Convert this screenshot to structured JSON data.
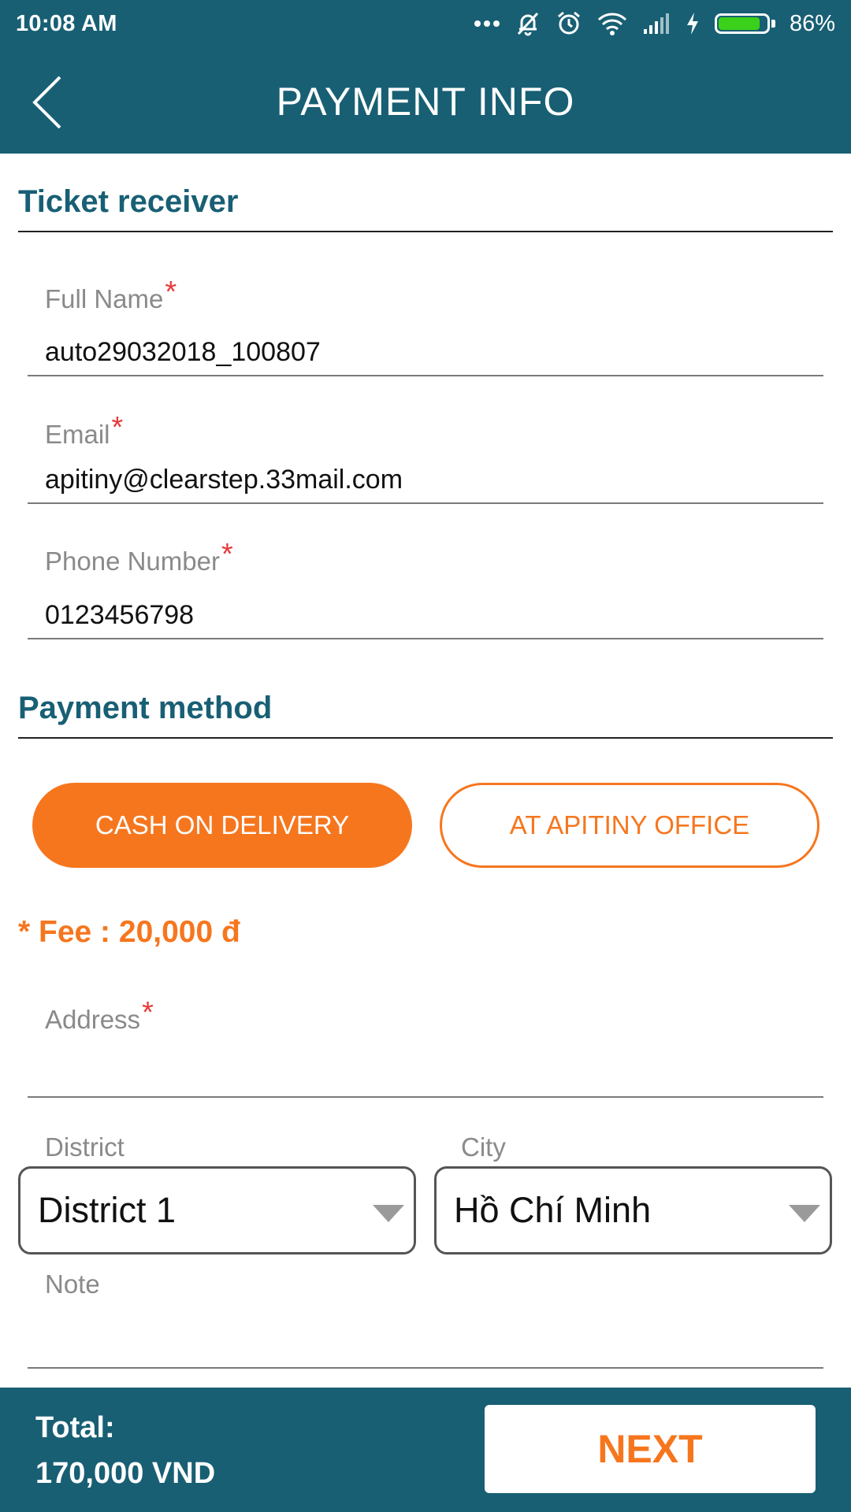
{
  "status_bar": {
    "time": "10:08 AM",
    "battery_percent": "86%",
    "battery_level": 0.86,
    "icons": [
      "more-dots-icon",
      "silent-icon",
      "alarm-icon",
      "wifi-icon",
      "signal-icon",
      "charging-icon",
      "battery-icon"
    ]
  },
  "header": {
    "title": "PAYMENT INFO",
    "back_icon": "back-arrow-icon"
  },
  "ticket_receiver": {
    "section_title": "Ticket receiver",
    "full_name": {
      "label": "Full Name",
      "required": "*",
      "value": "auto29032018_100807"
    },
    "email": {
      "label": "Email",
      "required": "*",
      "value": "apitiny@clearstep.33mail.com"
    },
    "phone": {
      "label": "Phone Number",
      "required": "*",
      "value": "0123456798"
    }
  },
  "payment_method": {
    "section_title": "Payment method",
    "options": [
      {
        "label": "CASH ON DELIVERY",
        "selected": true
      },
      {
        "label": "AT APITINY OFFICE",
        "selected": false
      }
    ],
    "fee": "* Fee : 20,000 đ",
    "address": {
      "label": "Address",
      "required": "*",
      "value": ""
    },
    "district": {
      "label": "District",
      "value": "District 1"
    },
    "city": {
      "label": "City",
      "value": "Hồ Chí Minh"
    },
    "note": {
      "label": "Note",
      "value": ""
    }
  },
  "footer": {
    "total_label": "Total:",
    "total_value": "170,000 VND",
    "next_label": "NEXT"
  },
  "colors": {
    "primary": "#185f74",
    "accent": "#f6761e",
    "required": "#e63b3b",
    "battery": "#3bd11b"
  }
}
